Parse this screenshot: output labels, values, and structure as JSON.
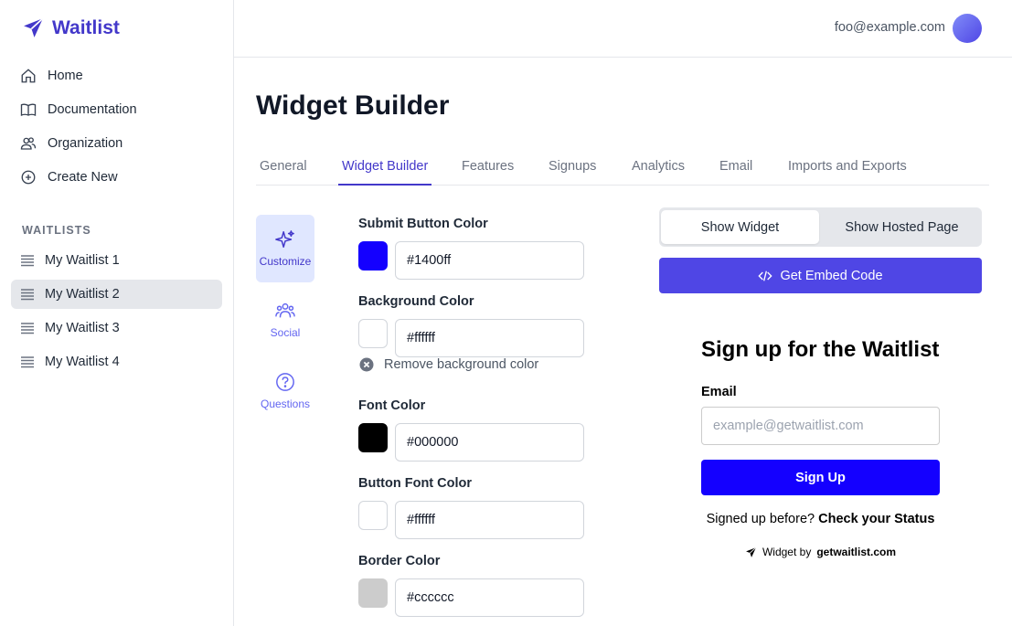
{
  "app": {
    "name": "Waitlist",
    "brand_color": "#4338ca"
  },
  "sidebar": {
    "nav": [
      {
        "label": "Home",
        "icon": "home-icon"
      },
      {
        "label": "Documentation",
        "icon": "book-icon"
      },
      {
        "label": "Organization",
        "icon": "users-icon"
      },
      {
        "label": "Create New",
        "icon": "plus-circle-icon"
      }
    ],
    "section_label": "WAITLISTS",
    "waitlists": [
      {
        "label": "My Waitlist 1",
        "active": false
      },
      {
        "label": "My Waitlist 2",
        "active": true
      },
      {
        "label": "My Waitlist 3",
        "active": false
      },
      {
        "label": "My Waitlist 4",
        "active": false
      }
    ]
  },
  "topbar": {
    "user_email": "foo@example.com"
  },
  "page": {
    "title": "Widget Builder",
    "tabs": [
      {
        "label": "General",
        "active": false
      },
      {
        "label": "Widget Builder",
        "active": true
      },
      {
        "label": "Features",
        "active": false
      },
      {
        "label": "Signups",
        "active": false
      },
      {
        "label": "Analytics",
        "active": false
      },
      {
        "label": "Email",
        "active": false
      },
      {
        "label": "Imports and Exports",
        "active": false
      }
    ]
  },
  "builder_nav": [
    {
      "label": "Customize",
      "icon": "sparkles-icon",
      "active": true
    },
    {
      "label": "Social",
      "icon": "user-group-icon",
      "active": false
    },
    {
      "label": "Questions",
      "icon": "question-circle-icon",
      "active": false
    }
  ],
  "colors": {
    "submit_button": {
      "label": "Submit Button Color",
      "value": "#1400ff"
    },
    "background": {
      "label": "Background Color",
      "value": "#ffffff",
      "remove_label": "Remove background color"
    },
    "font": {
      "label": "Font Color",
      "value": "#000000"
    },
    "button_font": {
      "label": "Button Font Color",
      "value": "#ffffff"
    },
    "border": {
      "label": "Border Color",
      "value": "#cccccc"
    }
  },
  "preview": {
    "toggle": {
      "show_widget": "Show Widget",
      "show_hosted": "Show Hosted Page",
      "selected": "Show Widget"
    },
    "embed_button": "Get Embed Code",
    "widget": {
      "title": "Sign up for the Waitlist",
      "email_label": "Email",
      "email_placeholder": "example@getwaitlist.com",
      "signup_button": "Sign Up",
      "status_prefix": "Signed up before?",
      "status_link": "Check your Status",
      "credit_prefix": "Widget by",
      "credit_link": "getwaitlist.com"
    }
  }
}
